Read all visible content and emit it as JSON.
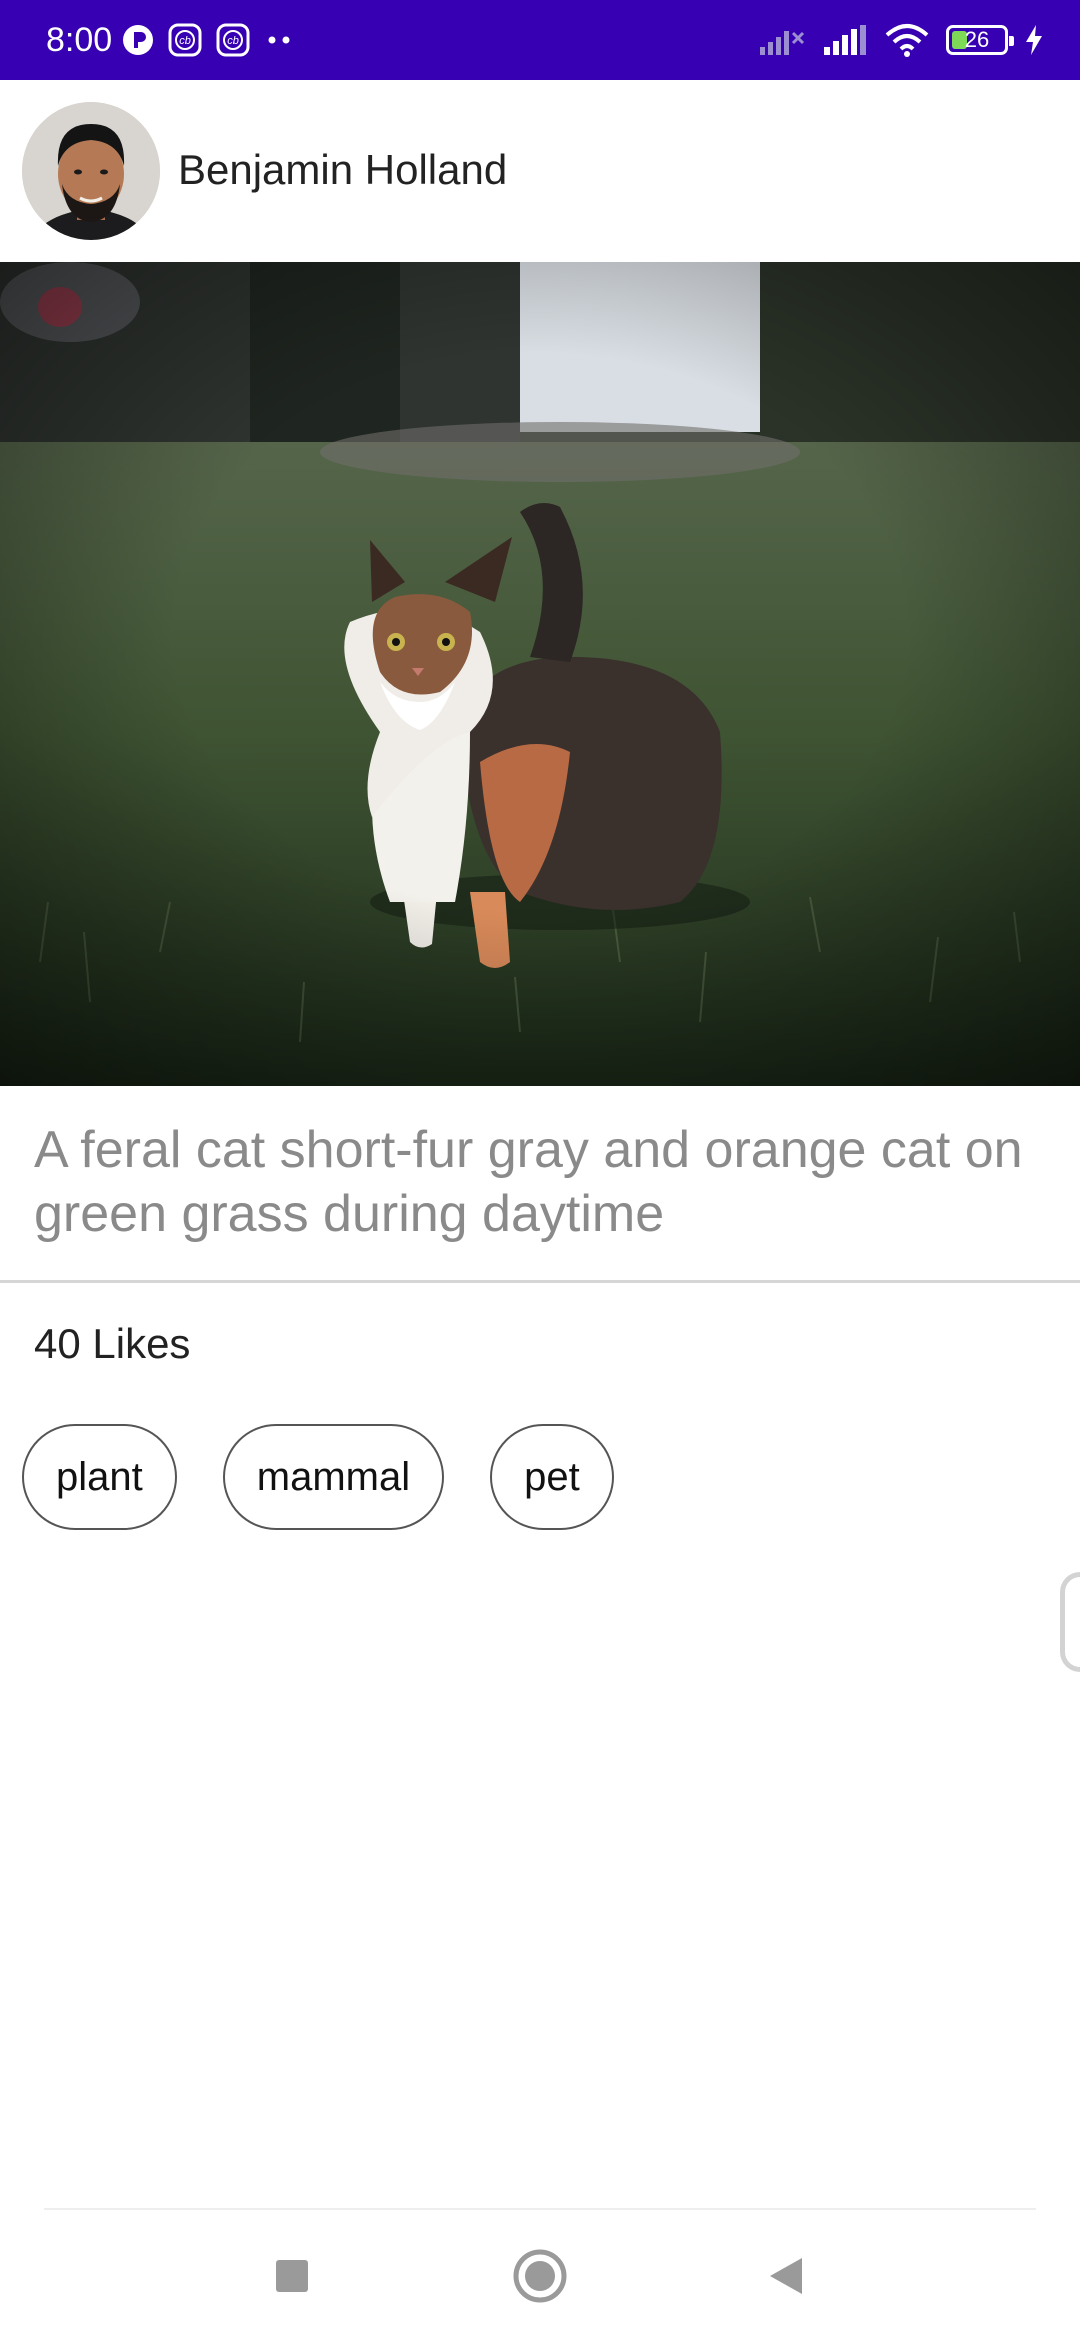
{
  "status_bar": {
    "time": "8:00",
    "battery_level": "26",
    "left_icons": [
      "notification-p-icon",
      "cb-app-icon",
      "cb-app-icon",
      "more-dots-icon"
    ],
    "right_icons": [
      "no-signal-icon",
      "signal-icon",
      "wifi-icon",
      "battery-icon",
      "charging-icon"
    ],
    "background": "#3700b3"
  },
  "post": {
    "author_name": "Benjamin Holland",
    "description": "A feral cat short-fur gray and orange cat on green grass during daytime",
    "likes": "40 Likes",
    "tags": [
      "plant",
      "mammal",
      "pet"
    ]
  },
  "nav_bar": {
    "buttons": [
      "recents-square-icon",
      "home-circle-icon",
      "back-triangle-icon"
    ]
  }
}
